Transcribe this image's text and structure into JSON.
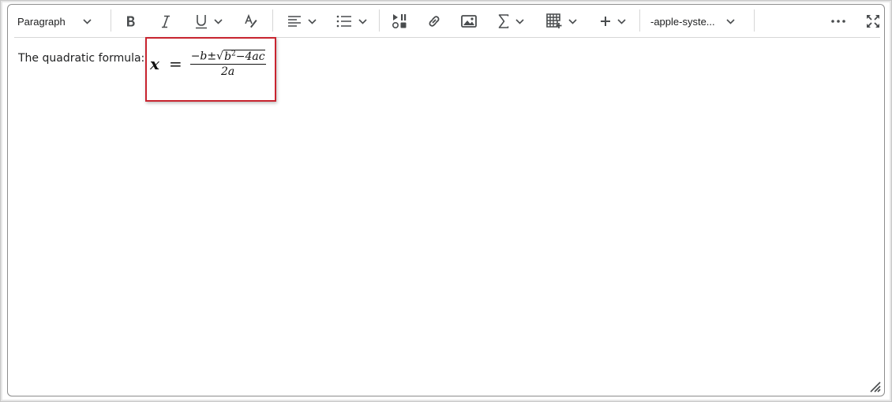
{
  "toolbar": {
    "block_format": "Paragraph",
    "font_family": "-apple-syste...",
    "icons": [
      "bold-icon",
      "italic-icon",
      "underline-icon",
      "clear-format-icon",
      "align-left-icon",
      "bullet-list-icon",
      "media-icon",
      "link-icon",
      "image-icon",
      "sigma-icon",
      "table-icon",
      "plus-icon",
      "more-icon",
      "fullscreen-icon"
    ]
  },
  "content": {
    "text": "The quadratic formula:",
    "equation": {
      "lhs": "x",
      "equals": "=",
      "numerator_prefix": "−b±",
      "radical": "√",
      "radicand_base": "b",
      "radicand_exp": "2",
      "radicand_rest": "−4ac",
      "denominator": "2a"
    }
  },
  "colors": {
    "highlight_border": "#c8242f",
    "icon": "#494c4e",
    "border": "#8c8c8c"
  }
}
